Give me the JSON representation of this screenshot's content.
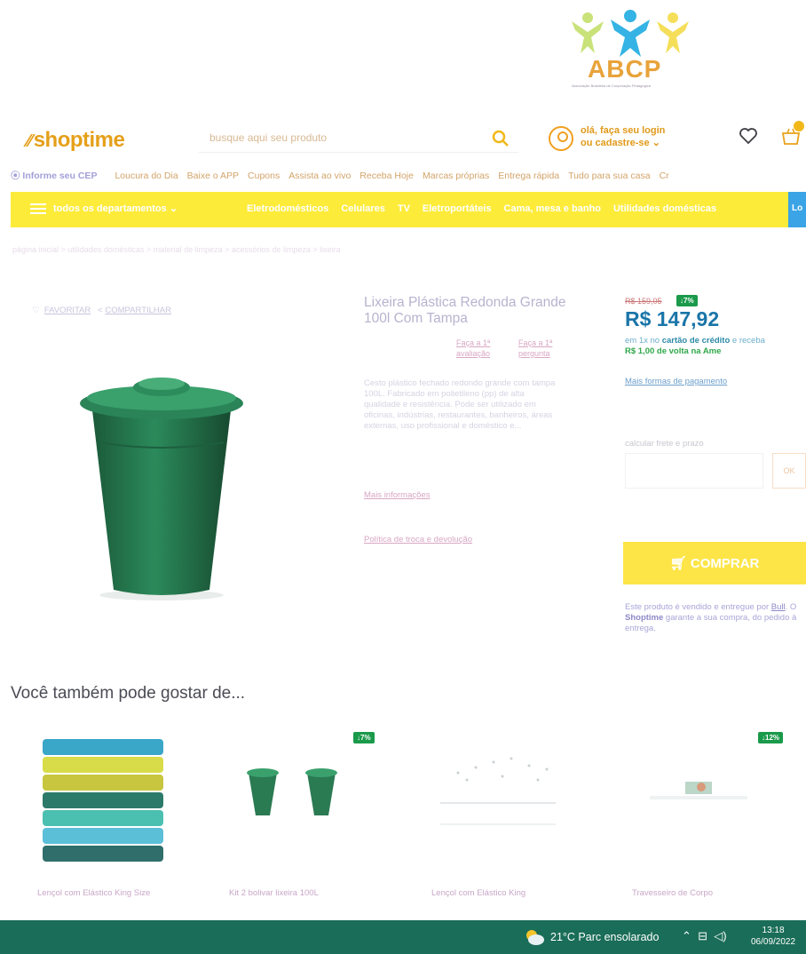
{
  "abcp_logo": {
    "text": "ABCP",
    "subtext": "Associação Brasileira de Cooperação Pedagógica"
  },
  "header": {
    "logo": "shoptime",
    "search_placeholder": "busque aqui seu produto",
    "account_line1": "olá, faça seu login",
    "account_line2": "ou cadastre-se"
  },
  "nav": {
    "cep": "Informe seu CEP",
    "links": [
      "Loucura do Dia",
      "Baixe o APP",
      "Cupons",
      "Assista ao vivo",
      "Receba Hoje",
      "Marcas próprias",
      "Entrega rápida",
      "Tudo para sua casa",
      "Cr"
    ]
  },
  "category_bar": {
    "menu_label": "todos os departamentos",
    "categories": [
      "Eletrodomésticos",
      "Celulares",
      "TV",
      "Eletroportáteis",
      "Cama, mesa e banho",
      "Utilidades domésticas"
    ],
    "right_tab": "Lo"
  },
  "breadcrumb": "página inicial  >  utilidades domésticas  >  material de limpeza  >  acessórios de limpeza  >  lixeira",
  "product": {
    "favorite_label": "FAVORITAR",
    "share_label": "COMPARTILHAR",
    "title": "Lixeira Plástica Redonda Grande 100l Com Tampa",
    "review_link_1": "Faça a 1ª avaliação",
    "review_link_2": "Faça a 1ª pergunta",
    "description": "Cesto plástico fechado redondo grande com tampa 100L. Fabricado em polietileno (pp) de alta qualidade e resistência. Pode ser utilizado em oficinas, indústrias, restaurantes, banheiros, áreas externas, uso profissional e doméstico e...",
    "more_info": "Mais informações",
    "policy": "Política de troca e devolução",
    "color": "#1f6b45"
  },
  "pricing": {
    "old_price": "R$ 159,05",
    "discount_badge": "↓7%",
    "price": "R$ 147,92",
    "installments_prefix": "em 1x no",
    "installments_card": "cartão de crédito",
    "installments_suffix": "e receba",
    "cashback": "R$ 1,00 de volta na Ame",
    "more_payment": "Mais formas de pagamento",
    "freight_label": "calcular frete e prazo",
    "ok_label": "OK",
    "buy_label": "COMPRAR",
    "sold_by_1": "Este produto é vendido e entregue por",
    "seller": "Bull",
    "sold_by_2": ". O",
    "brand": "Shoptime",
    "sold_by_3": "garante a sua compra, do pedido à entrega."
  },
  "recommendations": {
    "title": "Você também pode gostar de...",
    "items": [
      {
        "name": "Lençol com Elástico King Size",
        "badge": ""
      },
      {
        "name": "Kit 2 bolivar lixeira 100L",
        "badge": "↓7%"
      },
      {
        "name": "Lençol com Elástico King",
        "badge": ""
      },
      {
        "name": "Travesseiro de Corpo",
        "badge": "↓12%"
      }
    ]
  },
  "taskbar": {
    "weather": "21°C  Parc ensolarado",
    "time": "13:18",
    "date": "06/09/2022"
  }
}
